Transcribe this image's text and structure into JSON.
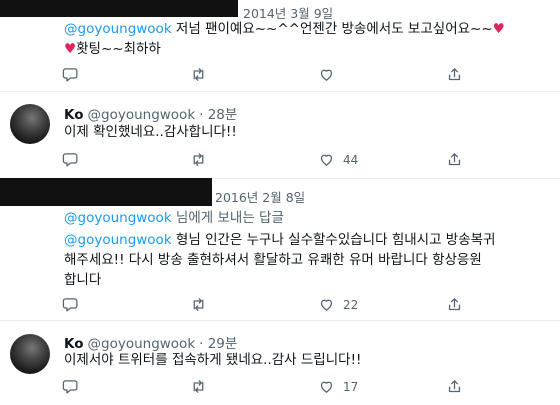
{
  "tweet1": {
    "date": "2014년 3월 9일",
    "mention": "@goyoungwook",
    "line1_text": " 저넘 팬이예요~~^^언젠간 방송에서도 보고싶어요~~",
    "line2_text": "홧팅~~최하하",
    "heart_glyph": "♥",
    "retweet_count": "",
    "like_count": ""
  },
  "reply1": {
    "name": "Ko",
    "handle": "@goyoungwook",
    "time": "· 28분",
    "text": "이제 확인했네요..감사합니다!!",
    "retweet_count": "",
    "like_count": "44"
  },
  "tweet2": {
    "date": "2016년 2월 8일",
    "reply_context_mention": "@goyoungwook",
    "reply_context_text": " 님에게 보내는 답글",
    "mention": "@goyoungwook",
    "line1_text": " 형님 인간은 누구나 실수할수있습니다  힘내시고 방송복귀",
    "line2_text": "해주세요!!  다시 방송 출현하셔서 활달하고 유쾌한 유머 바랍니다 항상응원",
    "line3_text": "합니다",
    "retweet_count": "",
    "like_count": "22"
  },
  "reply2": {
    "name": "Ko",
    "handle": "@goyoungwook",
    "time": "· 29분",
    "text": "이제서야 트위터를 접속하게 됐네요..감사 드립니다!!",
    "retweet_count": "",
    "like_count": "17"
  },
  "icons": [
    "reply-icon",
    "retweet-icon",
    "like-icon",
    "share-icon"
  ],
  "colors": {
    "link": "#1d9bf0",
    "muted": "#536471",
    "heart": "#e0245e",
    "redaction": "#111111"
  }
}
